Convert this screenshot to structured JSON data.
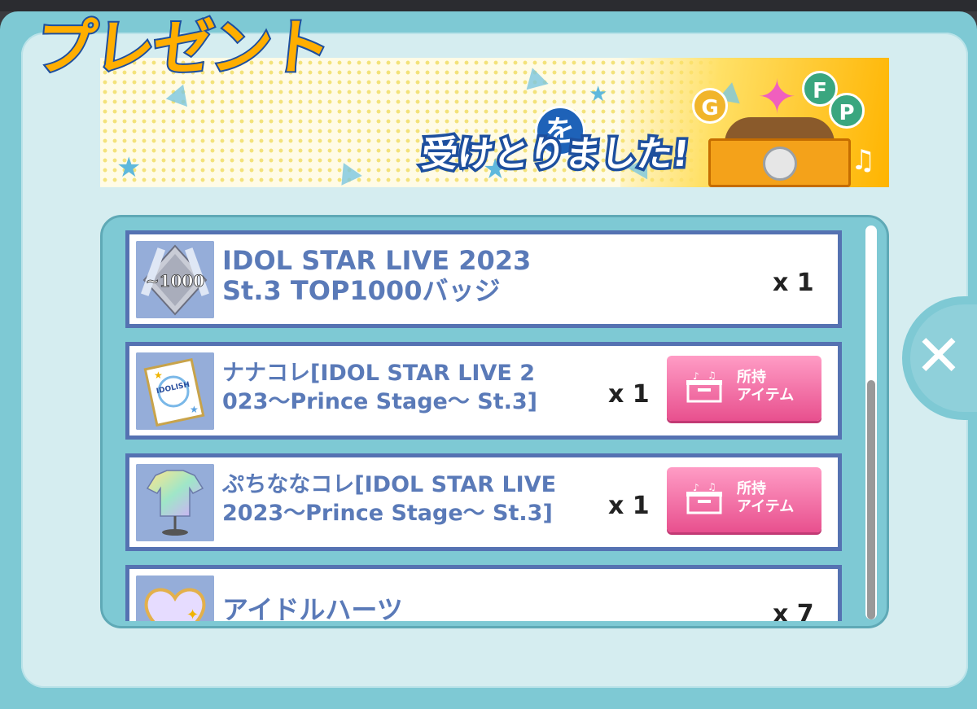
{
  "banner": {
    "title": "プレゼント",
    "particle": "を",
    "subtitle": "受けとりました!",
    "coin_g": "G",
    "coin_f": "F",
    "coin_p": "P"
  },
  "items": [
    {
      "name": "IDOL STAR LIVE 2023\nSt.3 TOP1000バッジ",
      "qty": "x 1",
      "icon": "badge-icon",
      "has_button": false
    },
    {
      "name": "ナナコレ[IDOL STAR LIVE 2\n023〜Prince Stage〜 St.3]",
      "qty": "x 1",
      "icon": "collection-book-icon",
      "has_button": true
    },
    {
      "name": "ぷちななコレ[IDOL STAR LIVE\n2023〜Prince Stage〜 St.3]",
      "qty": "x 1",
      "icon": "tshirt-icon",
      "has_button": true
    },
    {
      "name": "アイドルハーツ",
      "qty": "x 7",
      "icon": "heart-icon",
      "has_button": false
    }
  ],
  "owned_button_label": "所持\nアイテム",
  "close_label": "✕",
  "colors": {
    "accent": "#7ec9d4",
    "item_border": "#5572b2",
    "item_text": "#5a7ab8",
    "button_pink": "#e8508e"
  }
}
